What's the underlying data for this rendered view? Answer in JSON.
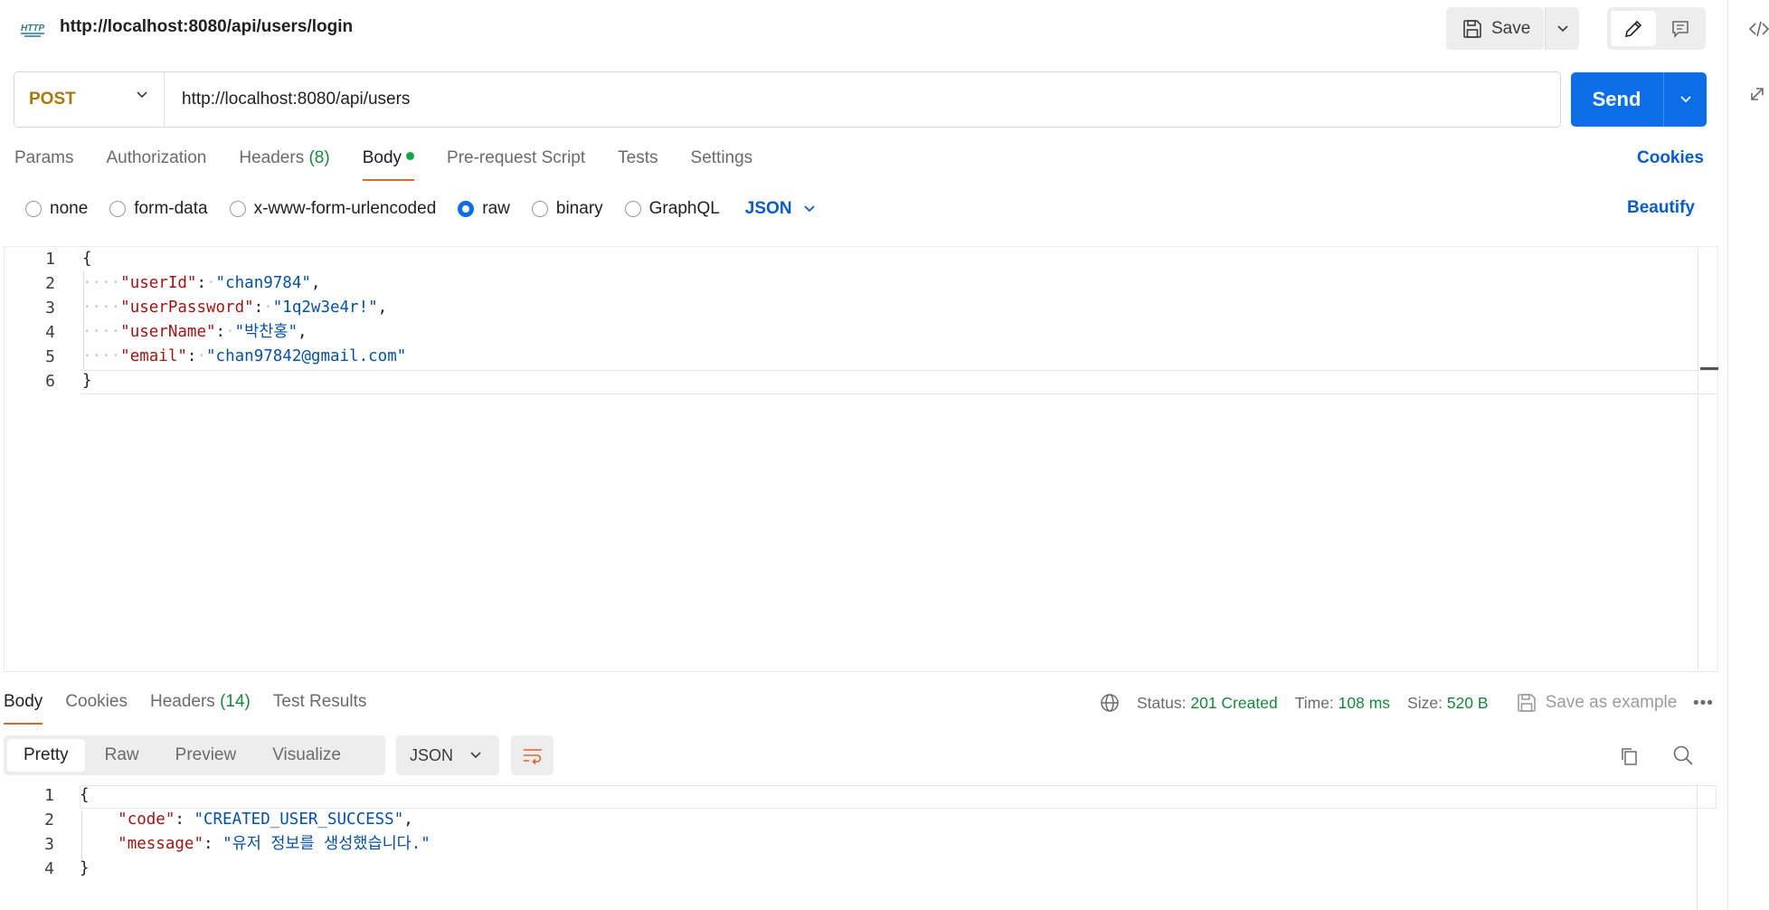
{
  "titlebar": {
    "title": "http://localhost:8080/api/users/login",
    "http_badge": "HTTP",
    "save_label": "Save"
  },
  "request": {
    "method": "POST",
    "url": "http://localhost:8080/api/users",
    "send_label": "Send"
  },
  "req_tabs": {
    "params": "Params",
    "authorization": "Authorization",
    "headers": "Headers",
    "headers_count": "(8)",
    "body": "Body",
    "pre_request": "Pre-request Script",
    "tests": "Tests",
    "settings": "Settings",
    "cookies": "Cookies"
  },
  "body_types": {
    "none": "none",
    "form_data": "form-data",
    "urlencoded": "x-www-form-urlencoded",
    "raw": "raw",
    "binary": "binary",
    "graphql": "GraphQL",
    "language": "JSON",
    "beautify": "Beautify"
  },
  "request_body": {
    "line_numbers": [
      "1",
      "2",
      "3",
      "4",
      "5",
      "6"
    ],
    "open": "{",
    "close": "}",
    "fields": [
      {
        "key": "\"userId\"",
        "value": "\"chan9784\"",
        "sep": ","
      },
      {
        "key": "\"userPassword\"",
        "value": "\"1q2w3e4r!\"",
        "sep": ","
      },
      {
        "key": "\"userName\"",
        "value": "\"박찬홍\"",
        "sep": ","
      },
      {
        "key": "\"email\"",
        "value": "\"chan97842@gmail.com\"",
        "sep": ""
      }
    ]
  },
  "res_tabs": {
    "body": "Body",
    "cookies": "Cookies",
    "headers": "Headers",
    "headers_count": "(14)",
    "test_results": "Test Results"
  },
  "status": {
    "status_label": "Status:",
    "status_value": "201 Created",
    "time_label": "Time:",
    "time_value": "108 ms",
    "size_label": "Size:",
    "size_value": "520 B",
    "save_example": "Save as example"
  },
  "format": {
    "pretty": "Pretty",
    "raw": "Raw",
    "preview": "Preview",
    "visualize": "Visualize",
    "language": "JSON"
  },
  "response_body": {
    "line_numbers": [
      "1",
      "2",
      "3",
      "4"
    ],
    "open": "{",
    "close": "}",
    "fields": [
      {
        "key": "\"code\"",
        "value": "\"CREATED_USER_SUCCESS\"",
        "sep": ","
      },
      {
        "key": "\"message\"",
        "value": "\"유저 정보를 생성했습니다.\"",
        "sep": ""
      }
    ]
  },
  "colors": {
    "accent": "#0c6fe8",
    "method": "#a97806",
    "success": "#17863e",
    "tab_underline": "#e0652b"
  }
}
